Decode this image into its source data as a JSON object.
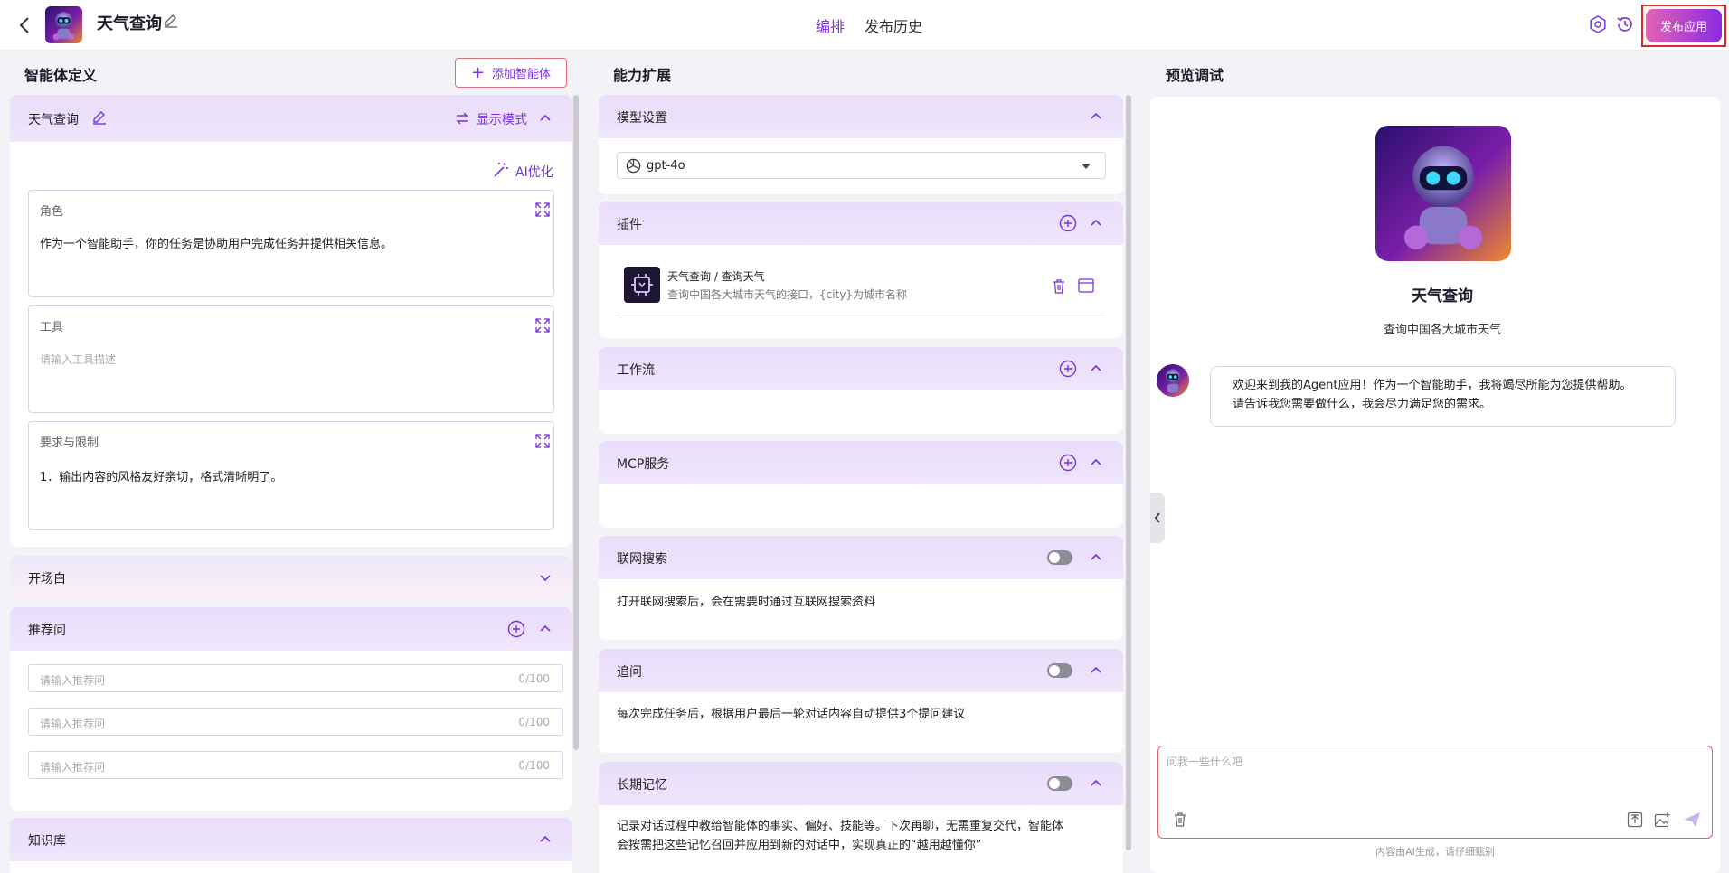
{
  "header": {
    "app_title": "天气查询",
    "tabs": [
      {
        "label": "编排",
        "active": true
      },
      {
        "label": "发布历史",
        "active": false
      }
    ],
    "publish_label": "发布应用"
  },
  "agent_def": {
    "title": "智能体定义",
    "add_agent_label": "添加智能体",
    "agent_name": "天气查询",
    "display_mode_label": "显示模式",
    "ai_optimize_label": "AI优化",
    "role": {
      "label": "角色",
      "value": "作为一个智能助手，你的任务是协助用户完成任务并提供相关信息。"
    },
    "tools": {
      "label": "工具",
      "placeholder": "请输入工具描述"
    },
    "requirements": {
      "label": "要求与限制",
      "value": "1．输出内容的风格友好亲切，格式清晰明了。"
    },
    "opening_label": "开场白",
    "recommend": {
      "label": "推荐问",
      "inputs": [
        {
          "placeholder": "请输入推荐问",
          "count": "0/100"
        },
        {
          "placeholder": "请输入推荐问",
          "count": "0/100"
        },
        {
          "placeholder": "请输入推荐问",
          "count": "0/100"
        }
      ]
    },
    "knowledge_label": "知识库"
  },
  "capability": {
    "title": "能力扩展",
    "model": {
      "label": "模型设置",
      "selected": "gpt-4o"
    },
    "plugins": {
      "label": "插件",
      "items": [
        {
          "name": "天气查询 / 查询天气",
          "desc": "查询中国各大城市天气的接口，{city}为城市名称"
        }
      ]
    },
    "workflow_label": "工作流",
    "mcp_label": "MCP服务",
    "web_search": {
      "label": "联网搜索",
      "desc": "打开联网搜索后，会在需要时通过互联网搜索资料",
      "enabled": false
    },
    "follow_up": {
      "label": "追问",
      "desc": "每次完成任务后，根据用户最后一轮对话内容自动提供3个提问建议",
      "enabled": false
    },
    "memory": {
      "label": "长期记忆",
      "desc_line1": "记录对话过程中教给智能体的事实、偏好、技能等。下次再聊，无需重复交代，智能体",
      "desc_line2": "会按需把这些记忆召回并应用到新的对话中，实现真正的“越用越懂你”",
      "enabled": false
    }
  },
  "preview": {
    "title": "预览调试",
    "app_name": "天气查询",
    "app_desc": "查询中国各大城市天气",
    "welcome_line1": "欢迎来到我的Agent应用！作为一个智能助手，我将竭尽所能为您提供帮助。",
    "welcome_line2": "请告诉我您需要做什么，我会尽力满足您的需求。",
    "input_placeholder": "问我一些什么吧",
    "disclaimer": "内容由AI生成，请仔细甄别"
  },
  "colors": {
    "accent": "#7a2fe0",
    "panel_head": "#e9ddfa",
    "publish_gradient_start": "#e264b4",
    "publish_gradient_end": "#8b2be0",
    "highlight_border": "#e22626"
  }
}
